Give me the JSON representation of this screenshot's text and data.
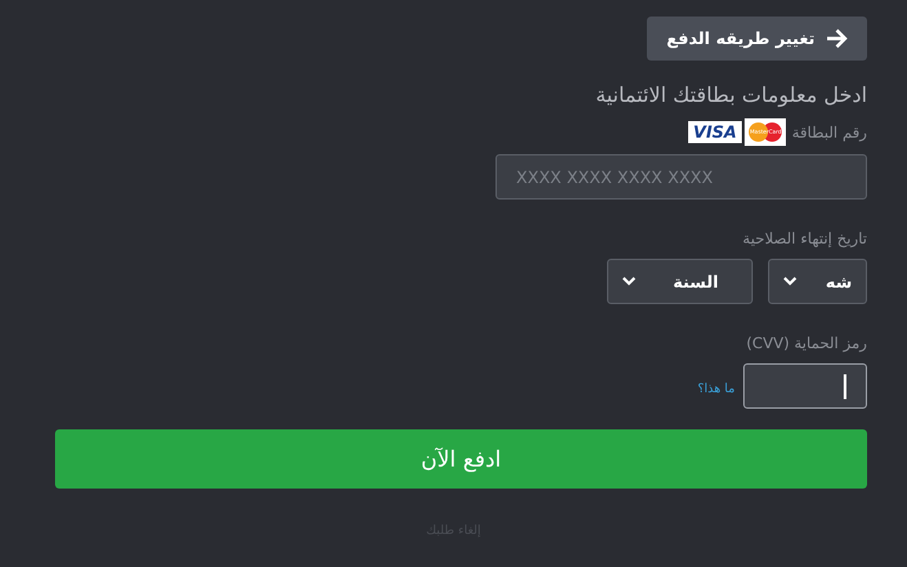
{
  "back_button": {
    "label": "تغيير طريقه الدفع"
  },
  "heading": "ادخل معلومات بطاقتك الائتمانية",
  "card_number": {
    "label": "رقم البطاقة",
    "logos": [
      {
        "kind": "mastercard",
        "text": "MasterCard"
      },
      {
        "kind": "visa",
        "text": "VISA"
      }
    ],
    "placeholder": "XXXX XXXX XXXX XXXX"
  },
  "expiry": {
    "label": "تاريخ إنتهاء الصلاحية",
    "selects": [
      {
        "value": "شه"
      },
      {
        "value": "السنة"
      }
    ]
  },
  "cvv": {
    "label": "رمز الحماية (CVV)",
    "focused": true,
    "help_link": "ما هذا؟"
  },
  "pay_button": {
    "label": "ادفع الآن"
  },
  "cancel_link": "إلغاء طلبك"
}
